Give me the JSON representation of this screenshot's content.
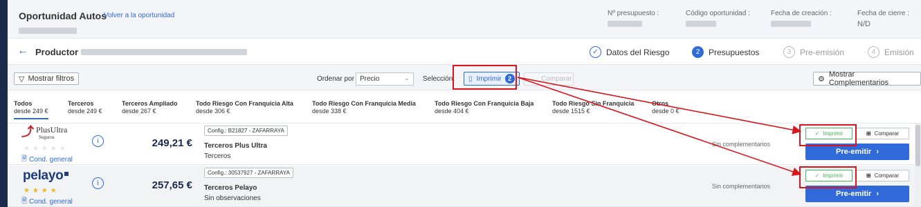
{
  "header": {
    "title": "Oportunidad Autos",
    "back_link": "Volver a la oportunidad",
    "meta": [
      {
        "label": "Nº presupuesto :"
      },
      {
        "label": "Código oportunidad :"
      },
      {
        "label": "Fecha de creación :"
      },
      {
        "label": "Fecha de cierre :",
        "value": "N/D"
      }
    ]
  },
  "product_row": {
    "label": "Productor",
    "steps": [
      {
        "num": "✓",
        "label": "Datos del Riesgo",
        "state": "done"
      },
      {
        "num": "2",
        "label": "Presupuestos",
        "state": "active"
      },
      {
        "num": "3",
        "label": "Pre-emisión",
        "state": "disabled"
      },
      {
        "num": "4",
        "label": "Emisión",
        "state": "disabled"
      }
    ]
  },
  "toolbar": {
    "filters_label": "Mostrar filtros",
    "order_label": "Ordenar por",
    "order_value": "Precio",
    "selection_label": "Selección:",
    "print_label": "Imprimir",
    "print_count": "2",
    "compare_label": "Comparar",
    "complements_label": "Mostrar Complementarios"
  },
  "tabs": [
    {
      "name": "Todos",
      "price": "desde 249 €"
    },
    {
      "name": "Terceros",
      "price": "desde 249 €"
    },
    {
      "name": "Terceros Ampliado",
      "price": "desde 267 €"
    },
    {
      "name": "Todo Riesgo Con Franquicia Alta",
      "price": "desde 306 €"
    },
    {
      "name": "Todo Riesgo Con Franquicia Media",
      "price": "desde 338 €"
    },
    {
      "name": "Todo Riesgo Con Franquicia Baja",
      "price": "desde 404 €"
    },
    {
      "name": "Todo Riesgo Sin Franquicia",
      "price": "desde 1515 €"
    },
    {
      "name": "Otros",
      "price": "desde 0 €"
    }
  ],
  "quotes": [
    {
      "logo_main": "PlusUltra",
      "logo_sub": "Seguros",
      "stars": "★★★★★",
      "cond": "Cond. general",
      "price": "249,21 €",
      "config": "Config.: B21827 - ZAFARRAYA",
      "product": "Terceros Plus Ultra",
      "desc": "Terceros",
      "complements": "Sin complementarios",
      "print": "Imprimir",
      "compare": "Comparar",
      "preemit": "Pre-emitir"
    },
    {
      "logo_main": "pelayo",
      "stars": "★★★★",
      "cond": "Cond. general",
      "price": "257,65 €",
      "config": "Config.: 30537927 - ZAFARRAYA",
      "product": "Terceros Pelayo",
      "desc": "Sin observaciones",
      "complements": "Sin complementarios",
      "print": "Imprimir",
      "compare": "Comparar",
      "preemit": "Pre-emitir"
    }
  ],
  "colors": {
    "accent": "#2f6ad8",
    "annotation": "#d9141b",
    "selected_print": "#45b35a",
    "brand_navy": "#1a2a4a"
  }
}
